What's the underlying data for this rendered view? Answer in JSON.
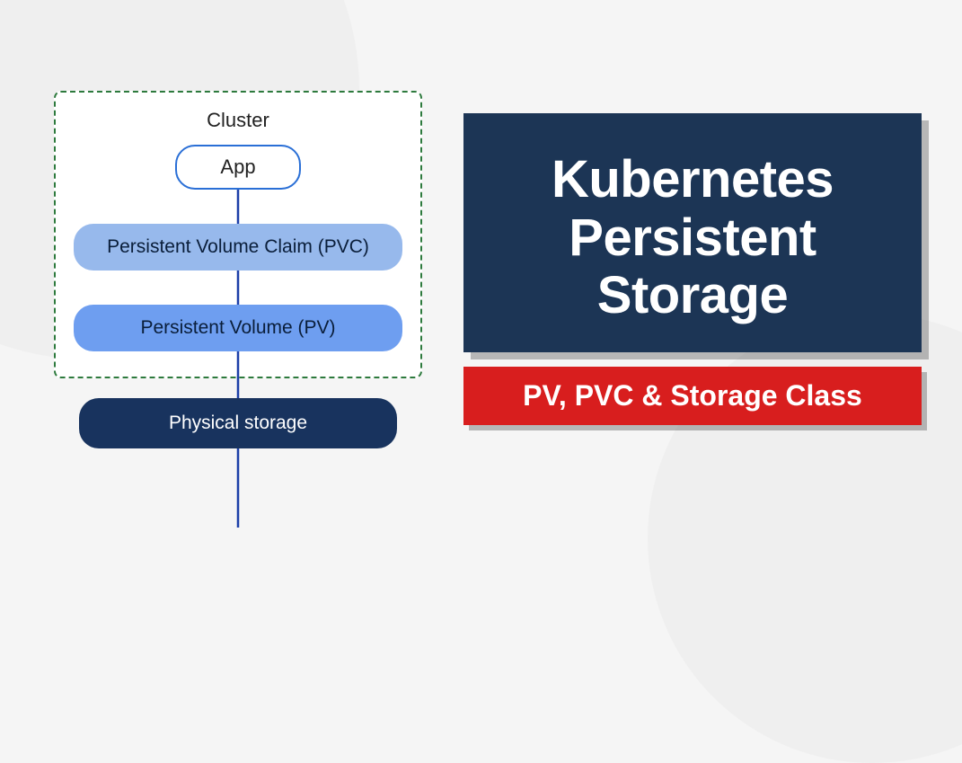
{
  "diagram": {
    "cluster_label": "Cluster",
    "app_label": "App",
    "pvc_label": "Persistent Volume Claim (PVC)",
    "pv_label": "Persistent Volume (PV)",
    "physical_label": "Physical storage"
  },
  "title": {
    "line1": "Kubernetes",
    "line2": "Persistent",
    "line3": "Storage",
    "subtitle": "PV, PVC & Storage Class"
  },
  "colors": {
    "cluster_border": "#2d7a3d",
    "app_border": "#2a6fd6",
    "pvc_bg": "#97b9ec",
    "pv_bg": "#6e9ef0",
    "physical_bg": "#18335e",
    "title_bg": "#1c3555",
    "subtitle_bg": "#d81e1e",
    "arrow": "#1c3fa8"
  }
}
